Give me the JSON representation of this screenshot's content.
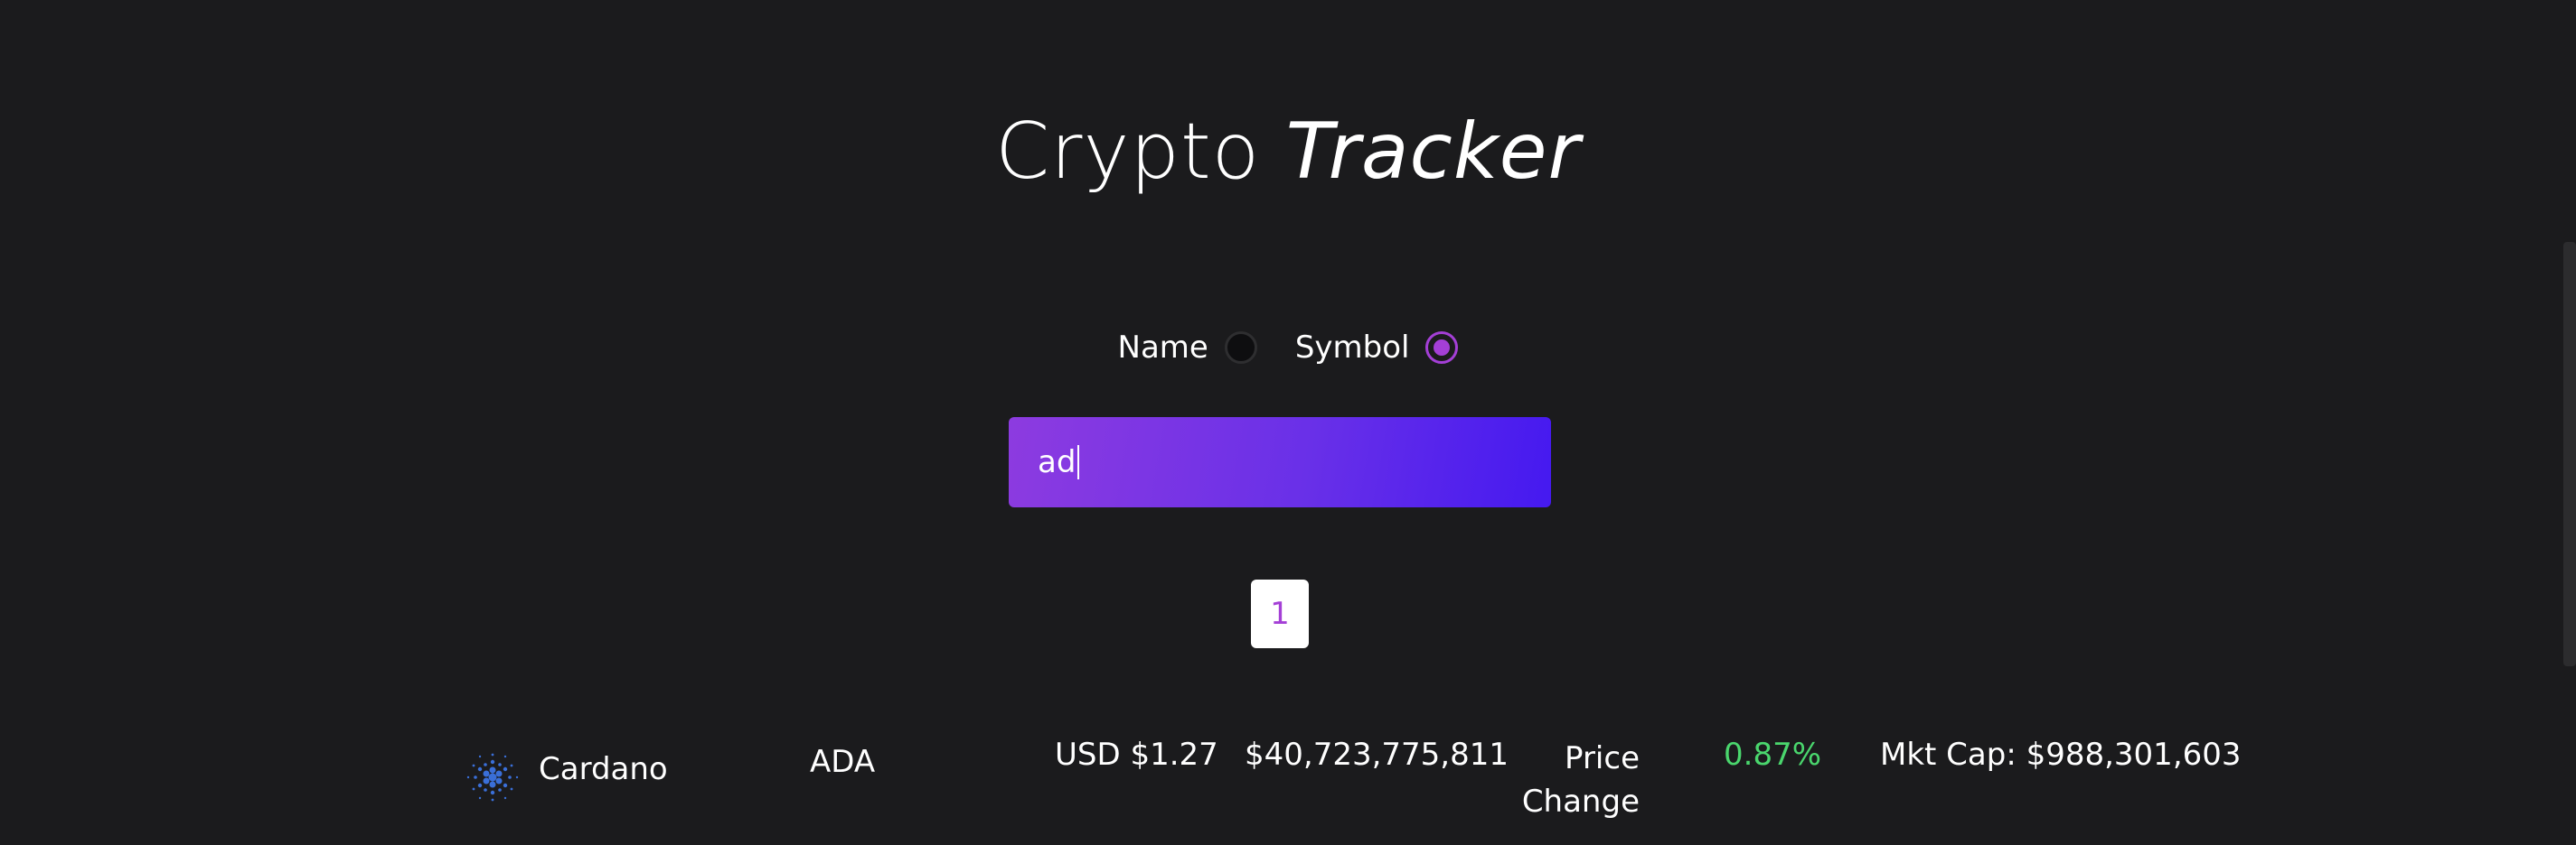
{
  "header": {
    "title_part1": "Crypto",
    "title_part2": "Tracker"
  },
  "search_mode": {
    "options": [
      {
        "label": "Name",
        "selected": false
      },
      {
        "label": "Symbol",
        "selected": true
      }
    ],
    "accent_color": "#a43fd6"
  },
  "search": {
    "value": "ad"
  },
  "pagination": {
    "pages": [
      "1"
    ],
    "current": "1"
  },
  "coins": [
    {
      "icon": "cardano-icon",
      "name": "Cardano",
      "symbol": "ADA",
      "price": "USD $1.27",
      "volume": "$40,723,775,811",
      "price_change_label": "Price Change",
      "price_change": "0.87%",
      "price_change_color": "#4ad66d",
      "market_cap": "Mkt Cap: $988,301,603"
    }
  ]
}
